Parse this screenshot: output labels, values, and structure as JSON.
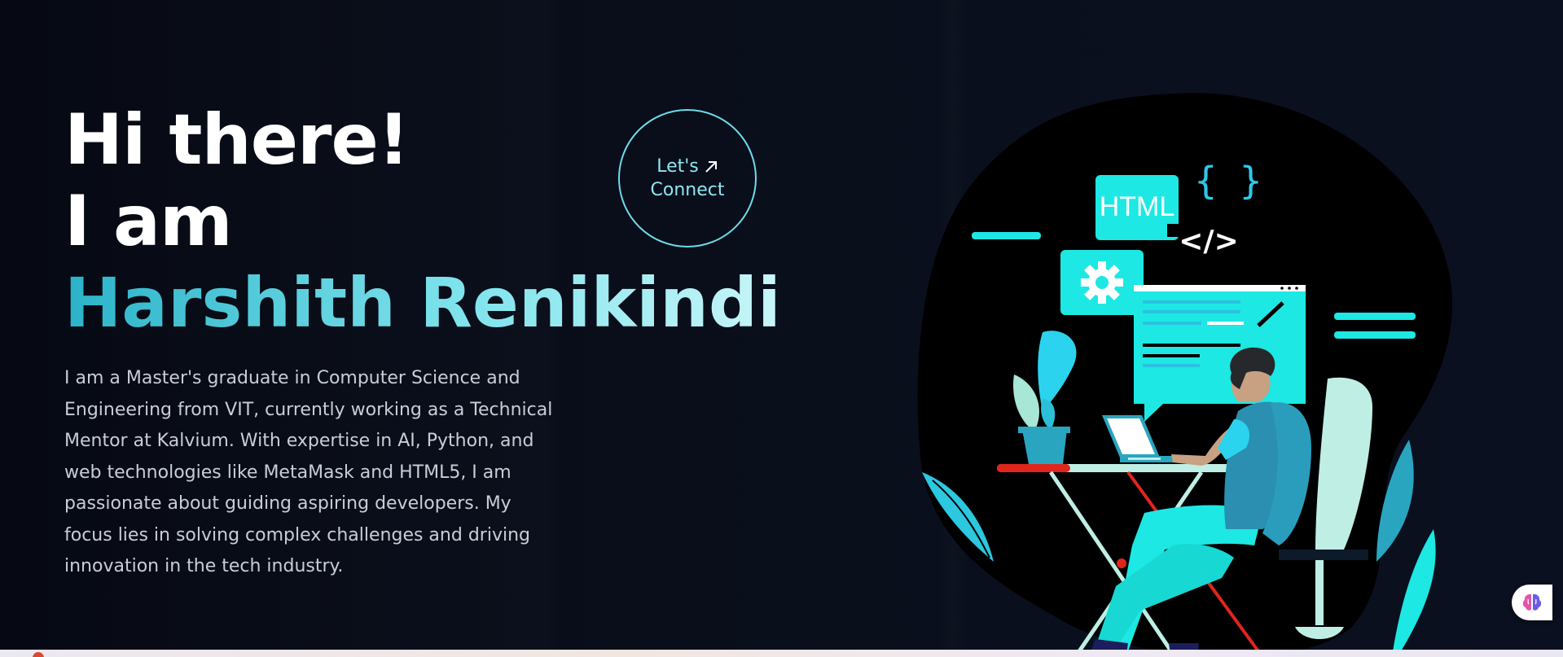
{
  "hero": {
    "greeting": "Hi there!",
    "intro": "I am",
    "name": "Harshith Renikindi",
    "bio": "I am a Master's graduate in Computer Science and Engineering from VIT, currently working as a Technical Mentor at Kalvium. With expertise in AI, Python, and web technologies like MetaMask and HTML5, I am passionate about guiding aspiring developers. My focus lies in solving complex challenges and driving innovation in the tech industry."
  },
  "connect": {
    "line1": "Let's",
    "line2": "Connect",
    "icon": "arrow-up-right-icon"
  },
  "illustration": {
    "badge_html": "HTML",
    "braces": "{ }",
    "code_tag": "</>"
  },
  "fab": {
    "icon": "brain-icon"
  },
  "colors": {
    "background": "#070b16",
    "accent": "#1de8e3",
    "name_gradient_start": "#2bb3c9",
    "name_gradient_end": "#c8f6f8",
    "body_text": "#c9cdd6"
  }
}
